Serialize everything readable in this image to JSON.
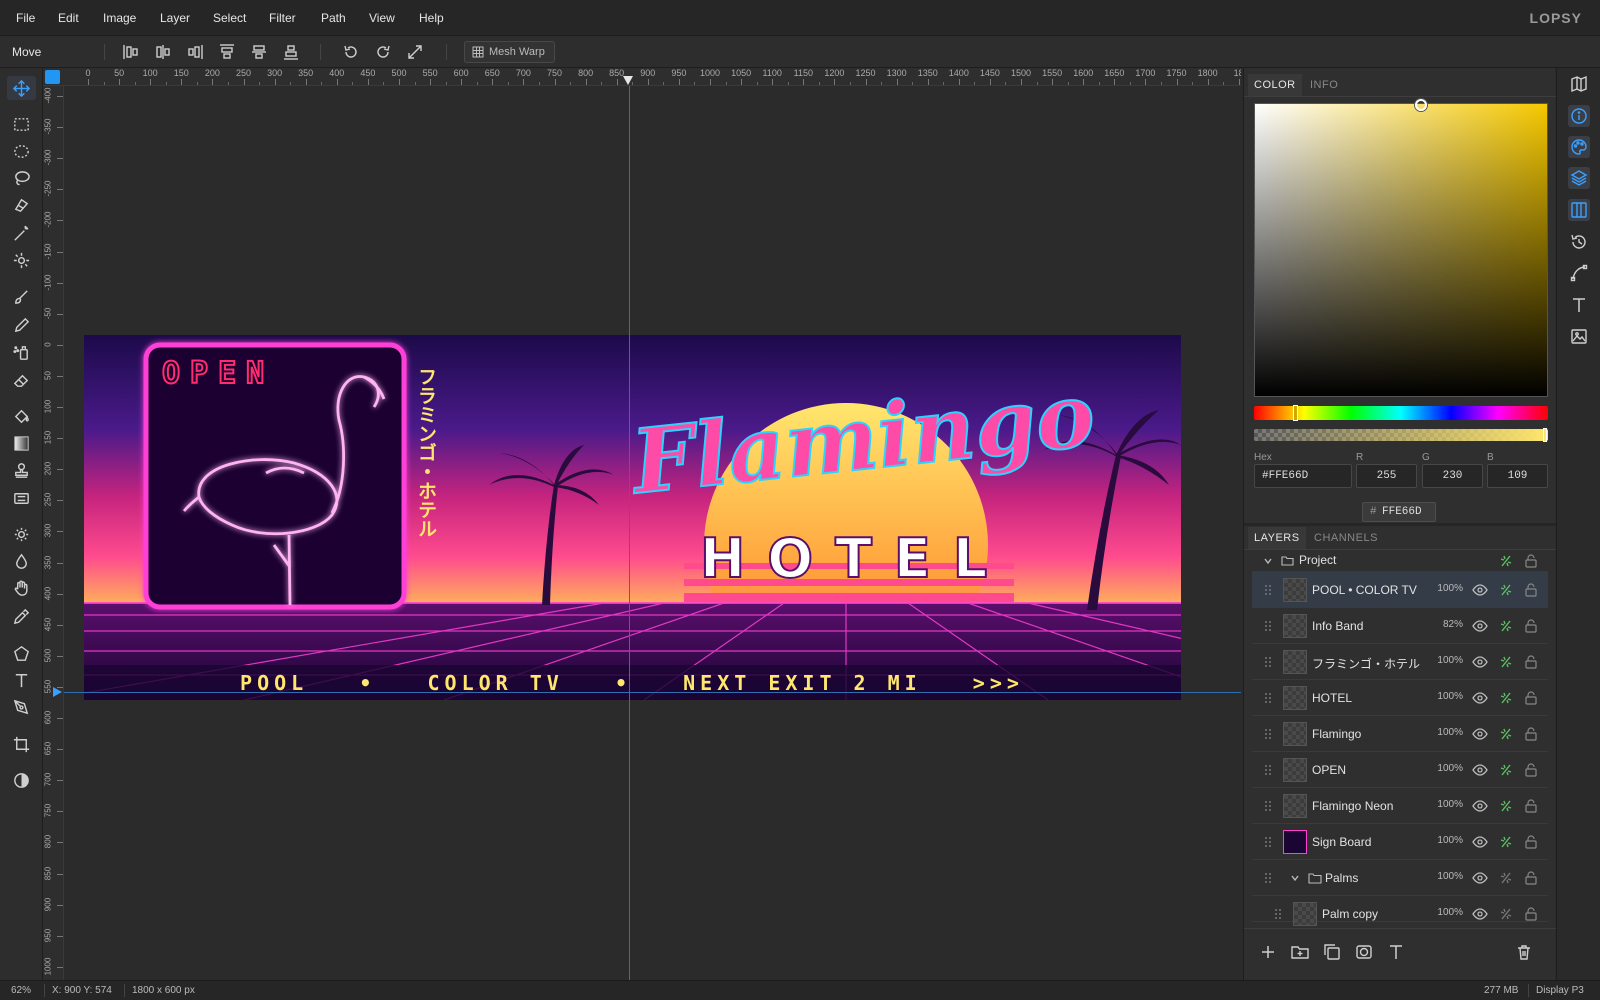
{
  "app": {
    "logo": "LOPSY"
  },
  "menu": [
    "File",
    "Edit",
    "Image",
    "Layer",
    "Select",
    "Filter",
    "Path",
    "View",
    "Help"
  ],
  "options_bar": {
    "tool_name": "Move",
    "mesh_warp_label": "Mesh Warp"
  },
  "rulers": {
    "horizontal": [
      "0",
      "50",
      "100",
      "150",
      "200",
      "250",
      "300",
      "350",
      "400",
      "450",
      "500",
      "550",
      "600",
      "650",
      "700",
      "750",
      "800",
      "850",
      "900",
      "950",
      "1000",
      "1050",
      "1100",
      "1150",
      "1200",
      "1250",
      "1300",
      "1350",
      "1400",
      "1450",
      "1500",
      "1550",
      "1600",
      "1650",
      "1700",
      "1750",
      "1800",
      "18"
    ],
    "vertical": [
      "-400",
      "-350",
      "-300",
      "-250",
      "-200",
      "-150",
      "-100",
      "-50",
      "0",
      "50",
      "100",
      "150",
      "200",
      "250",
      "300",
      "350",
      "400",
      "450",
      "500",
      "550",
      "600",
      "650",
      "700",
      "750",
      "800",
      "850",
      "900",
      "950",
      "1000"
    ]
  },
  "artwork": {
    "open_sign": "OPEN",
    "katakana": "フラミンゴ・ホテル",
    "script_title": "Flamingo",
    "hotel": "HOTEL",
    "info_band": "POOL   •   COLOR TV   •   NEXT EXIT 2 MI   >>>"
  },
  "color_panel": {
    "tabs": [
      "COLOR",
      "INFO"
    ],
    "hex_label": "Hex",
    "hex_value": "#FFE66D",
    "r_label": "R",
    "r_value": "255",
    "g_label": "G",
    "g_value": "230",
    "b_label": "B",
    "b_value": "109",
    "hex_chip_prefix": "#",
    "hex_chip_value": "FFE66D",
    "current_color": "#FFE66D",
    "hue_color": "#F5C800"
  },
  "layers_panel": {
    "tabs": [
      "LAYERS",
      "CHANNELS"
    ],
    "group_name": "Project",
    "layers": [
      {
        "name": "POOL • COLOR TV",
        "opacity": "100%"
      },
      {
        "name": "Info Band",
        "opacity": "82%"
      },
      {
        "name": "フラミンゴ・ホテル",
        "opacity": "100%"
      },
      {
        "name": "HOTEL",
        "opacity": "100%"
      },
      {
        "name": "Flamingo",
        "opacity": "100%"
      },
      {
        "name": "OPEN",
        "opacity": "100%"
      },
      {
        "name": "Flamingo Neon",
        "opacity": "100%"
      },
      {
        "name": "Sign Board",
        "opacity": "100%"
      },
      {
        "name": "Palms",
        "opacity": "100%"
      },
      {
        "name": "Palm copy",
        "opacity": "100%"
      }
    ]
  },
  "status": {
    "zoom": "62%",
    "cursor": "X: 900 Y: 574",
    "doc_size": "1800 x 600 px",
    "memory": "277 MB",
    "profile": "Display P3"
  }
}
